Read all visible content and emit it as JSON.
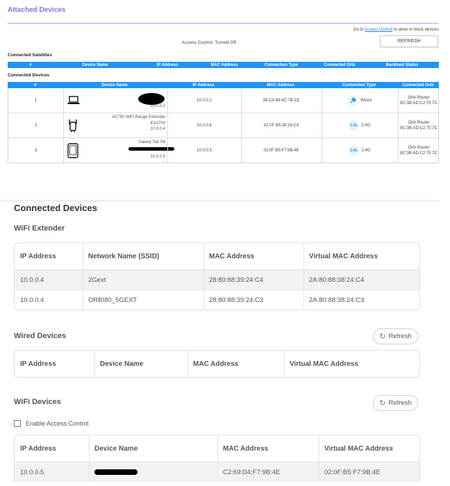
{
  "top": {
    "title": "Attached Devices",
    "goto_prefix": "Go to",
    "goto_link": "Access Control",
    "goto_suffix": "to allow or block devices",
    "refresh_label": "REFRESH",
    "access_control_status": "Access Control: Turned Off",
    "satellites_label": "Connected Satellites",
    "satellites_columns": [
      "#",
      "Device Name",
      "IP Address",
      "MAC Address",
      "Connection Type",
      "Connected Orbi",
      "Backhaul Status"
    ],
    "devices_label": "Connected Devices",
    "devices_columns": [
      "#",
      "Device Name",
      "IP Address",
      "MAC Address",
      "Connection Type",
      "Connected Orbi"
    ],
    "devices": [
      {
        "num": "1",
        "icon": "laptop-icon",
        "name_lines": [
          "",
          "10.0.0.2"
        ],
        "ip": "10.0.0.2",
        "mac": "38:CA:84:4C:7B:CE",
        "conn": "Wired",
        "conn_icon": "wired-icon",
        "orbi_name": "Orbi Router",
        "orbi_mac": "8C:3B:AD:C2:75:7C"
      },
      {
        "num": "2",
        "icon": "range-extender-icon",
        "name_lines": [
          "AC750 WiFi Range Extender",
          "EX3700",
          "10.0.0.4"
        ],
        "ip": "10.0.0.4",
        "mac": "02:0F:B5:39:24:C4",
        "conn": "2.4G",
        "conn_icon": "wifi-24g-icon",
        "orbi_name": "Orbi Router",
        "orbi_mac": "8C:3B:AD:C2:75:7C"
      },
      {
        "num": "3",
        "icon": "tablet-icon",
        "name_lines": [
          "Galaxy Tab S6",
          "10.0.0.5"
        ],
        "ip": "10.0.0.5",
        "mac": "02:0F:B5:F7:9B:4E",
        "conn": "2.4G",
        "conn_icon": "wifi-24g-icon",
        "orbi_name": "Orbi Router",
        "orbi_mac": "8C:3B:AD:C2:75:7C"
      }
    ],
    "wifi_badge": "2.4G"
  },
  "bottom": {
    "title": "Connected Devices",
    "wifi_extender": {
      "label": "WiFi Extender",
      "columns": [
        "IP Address",
        "Network Name (SSID)",
        "MAC Address",
        "Virtual MAC Address"
      ],
      "rows": [
        [
          "10.0.0.4",
          "2Gext",
          "28:80:88:39:24:C4",
          "2A:80:88:38:24:C4"
        ],
        [
          "10.0.0.4",
          "ORBI80_5GEXT",
          "28:80:88:39:24:C3",
          "2A:80:88:38:24:C3"
        ]
      ]
    },
    "wired": {
      "label": "Wired Devices",
      "refresh_label": "Refresh",
      "columns": [
        "IP Address",
        "Device Name",
        "MAC Address",
        "Virtual MAC Address"
      ]
    },
    "wifi": {
      "label": "WiFi Devices",
      "refresh_label": "Refresh",
      "enable_ac_label": "Enable Access Control",
      "columns": [
        "IP Address",
        "Device Name",
        "MAC Address",
        "Virtual MAC Address"
      ],
      "rows": [
        [
          "10.0.0.5",
          "",
          "C2:69:D4:F7:9B:4E",
          "02:0F:B5:F7:9B:4E"
        ]
      ]
    }
  }
}
